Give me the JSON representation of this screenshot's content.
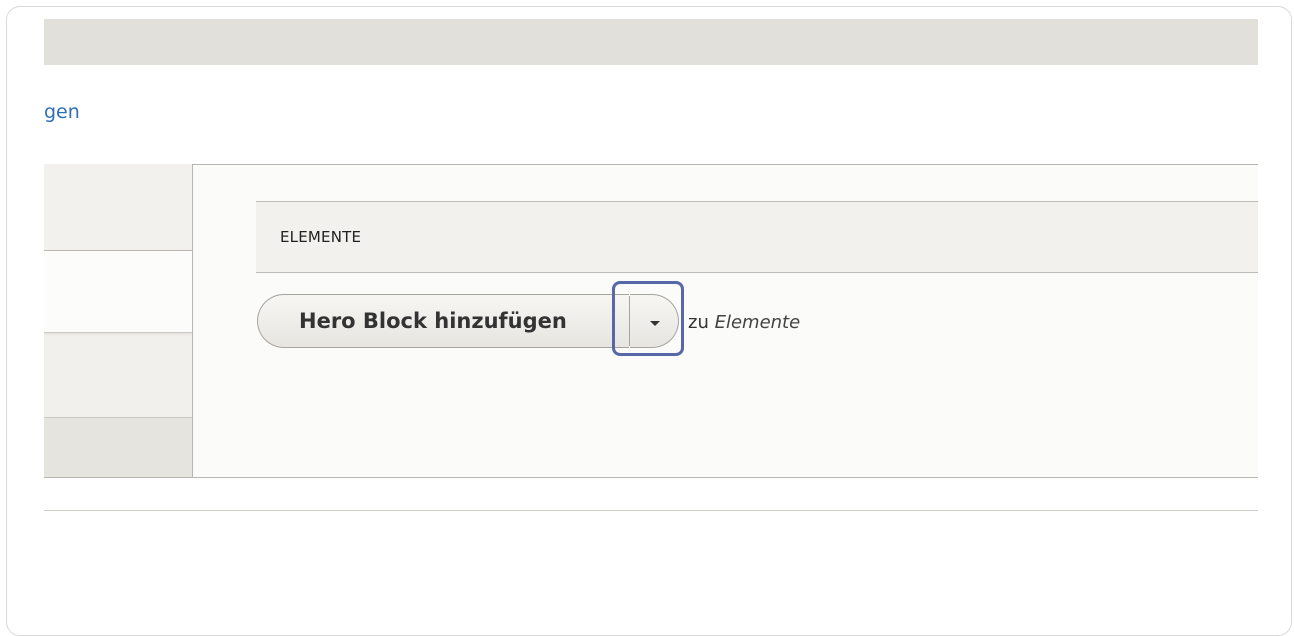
{
  "page": {
    "partial_link": "gen"
  },
  "table": {
    "header": "ELEMENTE"
  },
  "dropbutton": {
    "label": "Hero Block hinzufügen",
    "suffix_prefix": "zu",
    "suffix_target": "Elemente"
  },
  "colors": {
    "link": "#2f6fb7",
    "focus_ring": "#5767a7",
    "topbar": "#e2e0da"
  }
}
